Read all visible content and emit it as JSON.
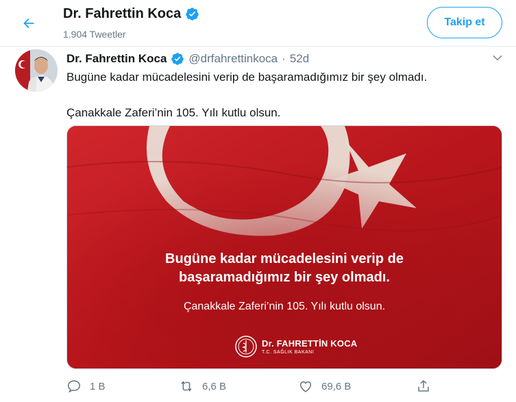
{
  "header": {
    "name": "Dr. Fahrettin Koca",
    "tweet_count": "1.904 Tweetler",
    "follow_label": "Takip et"
  },
  "tweet": {
    "author_name": "Dr. Fahrettin Koca",
    "handle": "@drfahrettinkoca",
    "separator": "·",
    "time": "52d",
    "text_line1": "Bugüne kadar mücadelesini verip de başaramadığımız bir şey olmadı.",
    "text_line2": "Çanakkale Zaferi’nin 105. Yılı kutlu olsun.",
    "media": {
      "line1": "Bugüne kadar mücadelesini verip de",
      "line2": "başaramadığımız bir şey olmadı.",
      "line3": "Çanakkale Zaferi’nin 105. Yılı kutlu olsun.",
      "logo_title": "Dr. FAHRETTİN KOCA",
      "logo_subtitle": "T.C. SAĞLIK BAKANI"
    },
    "actions": {
      "reply_count": "1 B",
      "retweet_count": "6,6 B",
      "like_count": "69,6 B"
    }
  },
  "colors": {
    "accent": "#1da1f2",
    "verified": "#1da1f2",
    "secondary_text": "#657786",
    "flag_red": "#c4161c"
  },
  "icons": {
    "back": "arrow-left-icon",
    "verified": "verified-badge-icon",
    "caret": "chevron-down-icon",
    "reply": "reply-icon",
    "retweet": "retweet-icon",
    "like": "heart-icon",
    "share": "share-icon"
  }
}
